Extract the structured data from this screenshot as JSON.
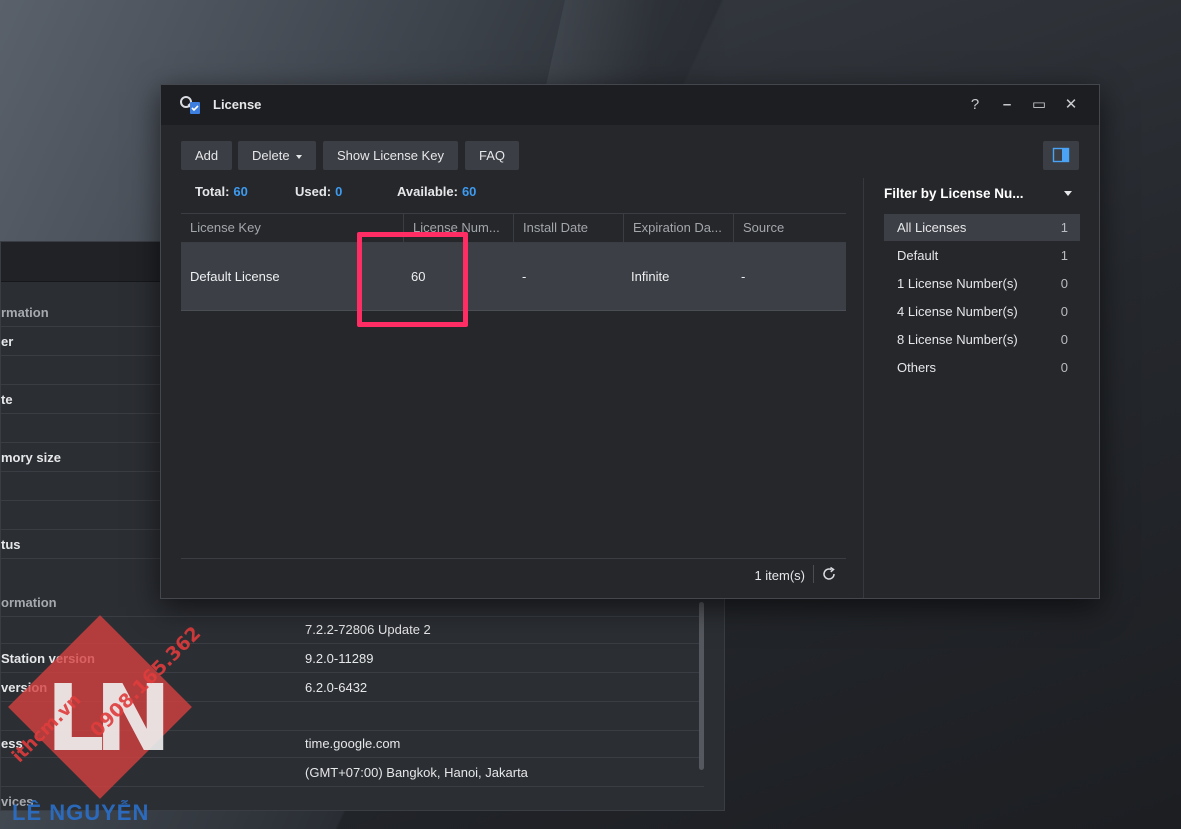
{
  "background_window": {
    "rows": [
      {
        "key": "rmation",
        "value": "",
        "section": true
      },
      {
        "key": "er",
        "value": ""
      },
      {
        "key": "",
        "value": ""
      },
      {
        "key": "te",
        "value": ""
      },
      {
        "key": "",
        "value": ""
      },
      {
        "key": "mory size",
        "value": ""
      },
      {
        "key": "",
        "value": ""
      },
      {
        "key": "",
        "value": ""
      },
      {
        "key": "tus",
        "value": ""
      },
      {
        "key": "ormation",
        "value": "",
        "section": true
      },
      {
        "key": "",
        "value": "7.2.2-72806 Update 2"
      },
      {
        "key": "Station version",
        "value": "9.2.0-11289"
      },
      {
        "key": "version",
        "value": "6.2.0-6432"
      },
      {
        "key": "",
        "value": ""
      },
      {
        "key": "ess",
        "value": "time.google.com"
      },
      {
        "key": "",
        "value": "(GMT+07:00) Bangkok, Hanoi, Jakarta"
      },
      {
        "key": "vices",
        "value": "",
        "section": true
      }
    ]
  },
  "watermark": {
    "logo": "LN",
    "phone": "0908.165.362",
    "site": "ithcm.vn",
    "name": "LÊ NGUYỄN"
  },
  "window": {
    "title": "License",
    "help": "?",
    "minimize": "–",
    "maximize": "▭",
    "close": "✕"
  },
  "toolbar": {
    "add": "Add",
    "delete": "Delete",
    "show_key": "Show License Key",
    "faq": "FAQ"
  },
  "stats": {
    "total_label": "Total:",
    "total": "60",
    "used_label": "Used:",
    "used": "0",
    "available_label": "Available:",
    "available": "60"
  },
  "grid": {
    "columns": [
      "License Key",
      "License Num...",
      "Install Date",
      "Expiration Da...",
      "Source"
    ],
    "rows": [
      {
        "key": "Default License",
        "number": "60",
        "install_date": "-",
        "expiration": "Infinite",
        "source": "-"
      }
    ],
    "footer": "1 item(s)"
  },
  "filter": {
    "title": "Filter by License Nu...",
    "items": [
      {
        "label": "All Licenses",
        "count": "1"
      },
      {
        "label": "Default",
        "count": "1"
      },
      {
        "label": "1 License Number(s)",
        "count": "0"
      },
      {
        "label": "4 License Number(s)",
        "count": "0"
      },
      {
        "label": "8 License Number(s)",
        "count": "0"
      },
      {
        "label": "Others",
        "count": "0"
      }
    ]
  },
  "colors": {
    "accent": "#3d9bf0",
    "highlight": "#ff2d64",
    "selected_row": "#3c3f45"
  }
}
